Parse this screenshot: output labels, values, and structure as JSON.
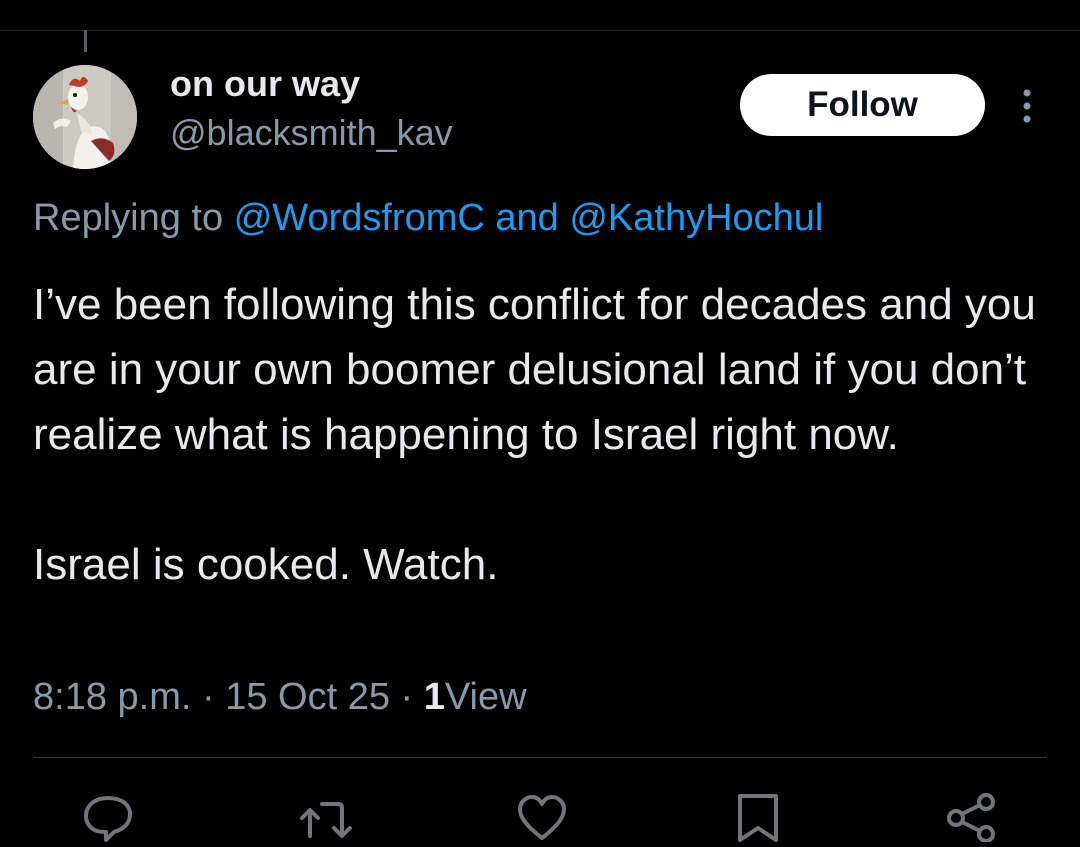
{
  "author": {
    "display_name": "on our way",
    "handle": "@blacksmith_kav"
  },
  "follow_label": "Follow",
  "reply_context": {
    "prefix": "Replying to",
    "mention_1": "@WordsfromC",
    "joiner": "and",
    "mention_2": "@KathyHochul"
  },
  "tweet": {
    "paragraph_1": "I’ve been following this conflict for decades and you are in your own boomer delusional land if you don’t realize what is happening to Israel right now.",
    "paragraph_2": "Israel is cooked. Watch."
  },
  "meta": {
    "time": "8:18 p.m.",
    "sep": "·",
    "date": "15 Oct 25",
    "views_count": "1",
    "views_label": "View"
  },
  "actions": [
    "reply-icon",
    "retweet-icon",
    "like-icon",
    "bookmark-icon",
    "share-icon"
  ],
  "colors": {
    "background": "#000000",
    "text": "#e7e9ea",
    "secondary": "#8b98a5",
    "link": "#1d9bf0",
    "button_bg": "#ffffff"
  }
}
